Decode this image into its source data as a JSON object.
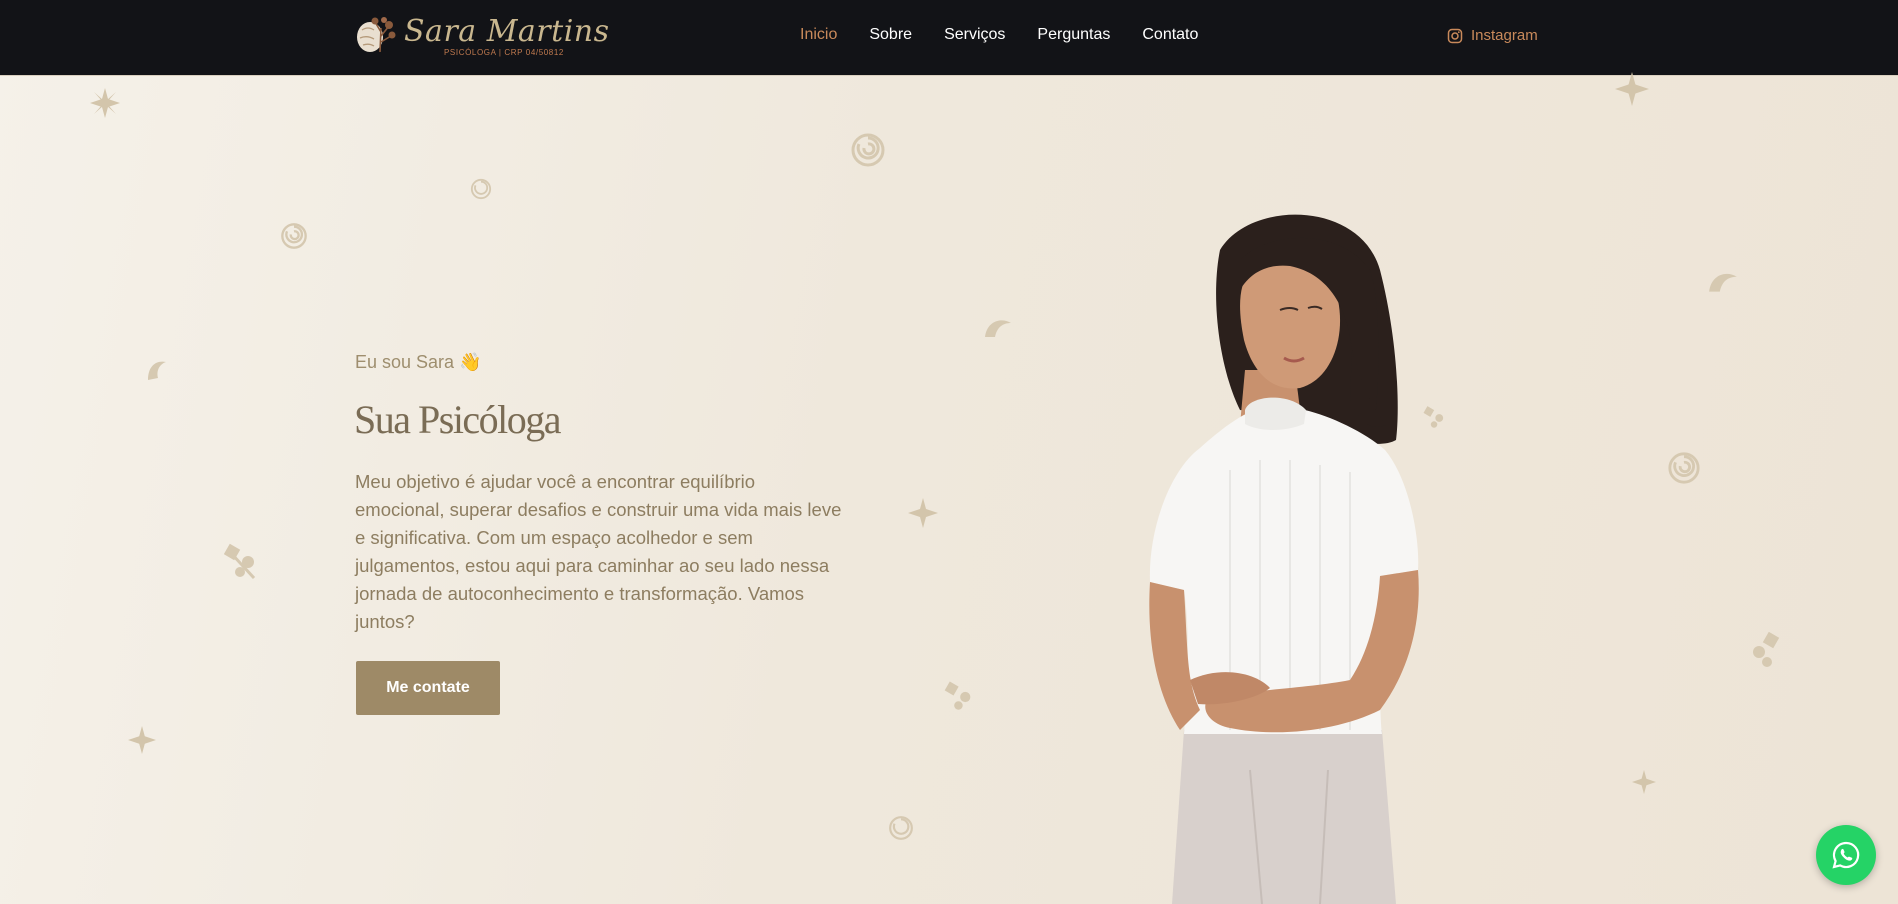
{
  "brand": {
    "name": "Sara Martins",
    "subtitle": "PSICÓLOGA | CRP 04/50812"
  },
  "nav": {
    "items": [
      {
        "label": "Inicio",
        "active": true
      },
      {
        "label": "Sobre"
      },
      {
        "label": "Serviços"
      },
      {
        "label": "Perguntas"
      },
      {
        "label": "Contato"
      }
    ]
  },
  "social": {
    "instagram_label": "Instagram"
  },
  "hero": {
    "greeting": "Eu sou Sara 👋",
    "title": "Sua Psicóloga",
    "text": "Meu objetivo é ajudar você a encontrar equilíbrio emocional, superar desafios e construir uma vida mais leve e significativa. Com um espaço acolhedor e sem julgamentos, estou aqui para caminhar ao seu lado nessa jornada de autoconhecimento e transformação. Vamos juntos?",
    "cta_label": "Me contate"
  },
  "colors": {
    "header_bg": "#121317",
    "accent": "#c98a5b",
    "button": "#9e8a67",
    "whatsapp": "#25d366"
  },
  "icons": {
    "instagram": "instagram-icon",
    "whatsapp": "whatsapp-icon",
    "logo": "brain-tree-logo-icon"
  }
}
